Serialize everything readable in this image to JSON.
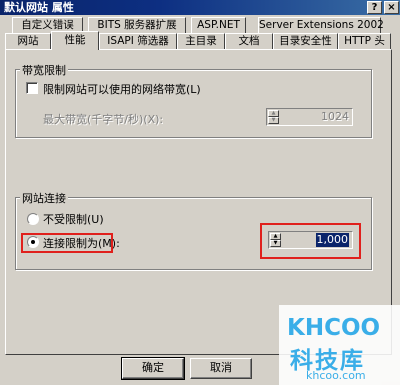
{
  "window": {
    "title": "默认网站 属性",
    "help_button": "?",
    "close_button": "×"
  },
  "tabs": {
    "row1": [
      "自定义错误",
      "BITS 服务器扩展",
      "ASP.NET",
      "Server Extensions 2002"
    ],
    "row2": [
      "网站",
      "性能",
      "ISAPI 筛选器",
      "主目录",
      "文档",
      "目录安全性",
      "HTTP 头"
    ],
    "active": "性能"
  },
  "bandwidth": {
    "group_title": "带宽限制",
    "limit_checkbox_label": "限制网站可以使用的网络带宽(L)",
    "limit_checked": false,
    "max_label": "最大带宽(千字节/秒)(X):",
    "max_value": "1024"
  },
  "connections": {
    "group_title": "网站连接",
    "unlimited_label": "不受限制(U)",
    "limit_label": "连接限制为(M):",
    "selected": "limit",
    "limit_value": "1,000"
  },
  "buttons": {
    "ok": "确定",
    "cancel": "取消"
  },
  "watermark": {
    "logo": "KHCOO",
    "name": "科技库",
    "url": "khcoo.com"
  },
  "colors": {
    "titlebar": "#0a246a",
    "highlight_box": "#e0201c",
    "watermark": "#3aaee8",
    "face": "#d4d0c8"
  }
}
